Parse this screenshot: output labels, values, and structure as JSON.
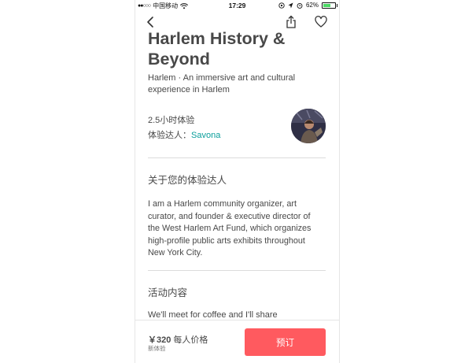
{
  "status_bar": {
    "carrier": "中国移动",
    "time": "17:29",
    "battery": "62%",
    "battery_level": 0.62
  },
  "nav": {
    "back_icon": "chevron-left-icon",
    "share_icon": "share-icon",
    "favorite_icon": "heart-icon"
  },
  "experience": {
    "title_line1": "Harlem History &",
    "title_line2": "Beyond",
    "subtitle_line1": "Harlem · An immersive art and cultural",
    "subtitle_line2": "experience in Harlem",
    "duration": "2.5小时体验",
    "host_label": "体验达人：",
    "host_name": "Savona"
  },
  "about_host": {
    "heading": "关于您的体验达人",
    "lines": [
      "I am a Harlem community organizer, art",
      "curator, and founder & executive director of",
      "the West Harlem Art Fund, which organizes",
      "high-profile public arts exhibits throughout",
      "New York City."
    ]
  },
  "activity": {
    "heading": "活动内容",
    "text_line1": "We'll meet for coffee and I'll share"
  },
  "booking": {
    "price": "￥320",
    "price_unit": "每人价格",
    "badge": "新体验",
    "button": "预订"
  },
  "colors": {
    "accent": "#ff5a5f",
    "link": "#0a9e9b",
    "text": "#484848"
  }
}
